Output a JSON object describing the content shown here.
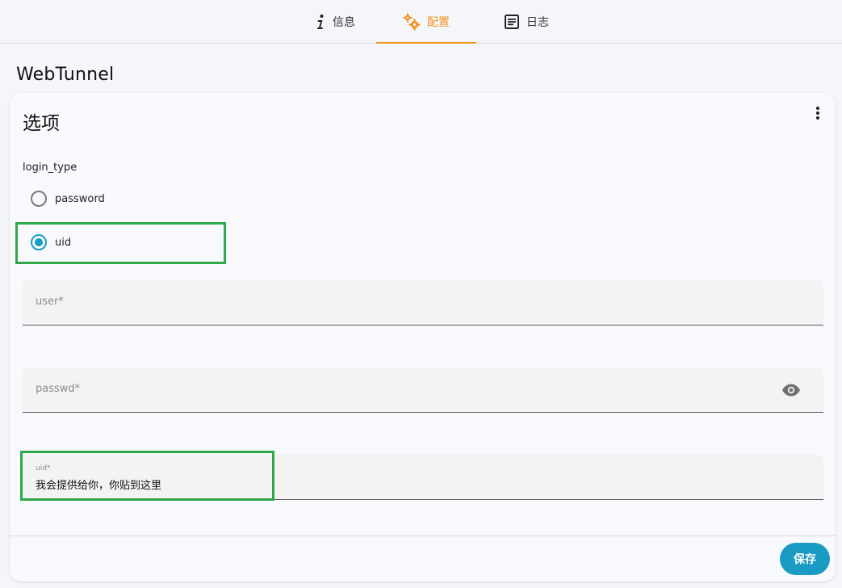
{
  "tabs": [
    {
      "id": "info",
      "label": "信息",
      "icon": "info-icon",
      "active": false
    },
    {
      "id": "config",
      "label": "配置",
      "icon": "gears-icon",
      "active": true
    },
    {
      "id": "log",
      "label": "日志",
      "icon": "document-icon",
      "active": false
    }
  ],
  "app_title": "WebTunnel",
  "card": {
    "title": "选项",
    "menu_icon": "more-vert-icon"
  },
  "login_type": {
    "label": "login_type",
    "options": [
      "password",
      "uid"
    ],
    "selected": "uid"
  },
  "fields": {
    "user": {
      "placeholder": "user*",
      "value": ""
    },
    "passwd": {
      "placeholder": "passwd*",
      "value": "",
      "icon": "eye-icon"
    },
    "uid": {
      "label": "uid*",
      "value": "我会提供给你，你贴到这里"
    }
  },
  "footer": {
    "save_label": "保存"
  },
  "colors": {
    "accent_tab": "#f0921e",
    "primary": "#1a9bc4",
    "highlight_box": "#2ea84a"
  }
}
